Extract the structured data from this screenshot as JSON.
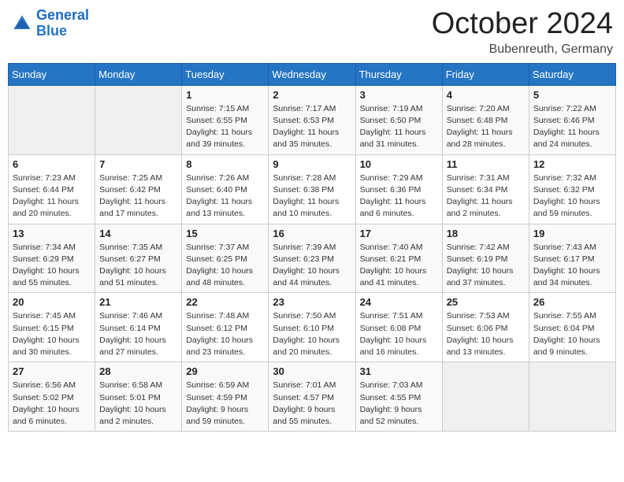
{
  "logo": {
    "text_general": "General",
    "text_blue": "Blue"
  },
  "header": {
    "month": "October 2024",
    "location": "Bubenreuth, Germany"
  },
  "days_of_week": [
    "Sunday",
    "Monday",
    "Tuesday",
    "Wednesday",
    "Thursday",
    "Friday",
    "Saturday"
  ],
  "weeks": [
    [
      {
        "day": null,
        "info": null
      },
      {
        "day": null,
        "info": null
      },
      {
        "day": "1",
        "info": "Sunrise: 7:15 AM\nSunset: 6:55 PM\nDaylight: 11 hours and 39 minutes."
      },
      {
        "day": "2",
        "info": "Sunrise: 7:17 AM\nSunset: 6:53 PM\nDaylight: 11 hours and 35 minutes."
      },
      {
        "day": "3",
        "info": "Sunrise: 7:19 AM\nSunset: 6:50 PM\nDaylight: 11 hours and 31 minutes."
      },
      {
        "day": "4",
        "info": "Sunrise: 7:20 AM\nSunset: 6:48 PM\nDaylight: 11 hours and 28 minutes."
      },
      {
        "day": "5",
        "info": "Sunrise: 7:22 AM\nSunset: 6:46 PM\nDaylight: 11 hours and 24 minutes."
      }
    ],
    [
      {
        "day": "6",
        "info": "Sunrise: 7:23 AM\nSunset: 6:44 PM\nDaylight: 11 hours and 20 minutes."
      },
      {
        "day": "7",
        "info": "Sunrise: 7:25 AM\nSunset: 6:42 PM\nDaylight: 11 hours and 17 minutes."
      },
      {
        "day": "8",
        "info": "Sunrise: 7:26 AM\nSunset: 6:40 PM\nDaylight: 11 hours and 13 minutes."
      },
      {
        "day": "9",
        "info": "Sunrise: 7:28 AM\nSunset: 6:38 PM\nDaylight: 11 hours and 10 minutes."
      },
      {
        "day": "10",
        "info": "Sunrise: 7:29 AM\nSunset: 6:36 PM\nDaylight: 11 hours and 6 minutes."
      },
      {
        "day": "11",
        "info": "Sunrise: 7:31 AM\nSunset: 6:34 PM\nDaylight: 11 hours and 2 minutes."
      },
      {
        "day": "12",
        "info": "Sunrise: 7:32 AM\nSunset: 6:32 PM\nDaylight: 10 hours and 59 minutes."
      }
    ],
    [
      {
        "day": "13",
        "info": "Sunrise: 7:34 AM\nSunset: 6:29 PM\nDaylight: 10 hours and 55 minutes."
      },
      {
        "day": "14",
        "info": "Sunrise: 7:35 AM\nSunset: 6:27 PM\nDaylight: 10 hours and 51 minutes."
      },
      {
        "day": "15",
        "info": "Sunrise: 7:37 AM\nSunset: 6:25 PM\nDaylight: 10 hours and 48 minutes."
      },
      {
        "day": "16",
        "info": "Sunrise: 7:39 AM\nSunset: 6:23 PM\nDaylight: 10 hours and 44 minutes."
      },
      {
        "day": "17",
        "info": "Sunrise: 7:40 AM\nSunset: 6:21 PM\nDaylight: 10 hours and 41 minutes."
      },
      {
        "day": "18",
        "info": "Sunrise: 7:42 AM\nSunset: 6:19 PM\nDaylight: 10 hours and 37 minutes."
      },
      {
        "day": "19",
        "info": "Sunrise: 7:43 AM\nSunset: 6:17 PM\nDaylight: 10 hours and 34 minutes."
      }
    ],
    [
      {
        "day": "20",
        "info": "Sunrise: 7:45 AM\nSunset: 6:15 PM\nDaylight: 10 hours and 30 minutes."
      },
      {
        "day": "21",
        "info": "Sunrise: 7:46 AM\nSunset: 6:14 PM\nDaylight: 10 hours and 27 minutes."
      },
      {
        "day": "22",
        "info": "Sunrise: 7:48 AM\nSunset: 6:12 PM\nDaylight: 10 hours and 23 minutes."
      },
      {
        "day": "23",
        "info": "Sunrise: 7:50 AM\nSunset: 6:10 PM\nDaylight: 10 hours and 20 minutes."
      },
      {
        "day": "24",
        "info": "Sunrise: 7:51 AM\nSunset: 6:08 PM\nDaylight: 10 hours and 16 minutes."
      },
      {
        "day": "25",
        "info": "Sunrise: 7:53 AM\nSunset: 6:06 PM\nDaylight: 10 hours and 13 minutes."
      },
      {
        "day": "26",
        "info": "Sunrise: 7:55 AM\nSunset: 6:04 PM\nDaylight: 10 hours and 9 minutes."
      }
    ],
    [
      {
        "day": "27",
        "info": "Sunrise: 6:56 AM\nSunset: 5:02 PM\nDaylight: 10 hours and 6 minutes."
      },
      {
        "day": "28",
        "info": "Sunrise: 6:58 AM\nSunset: 5:01 PM\nDaylight: 10 hours and 2 minutes."
      },
      {
        "day": "29",
        "info": "Sunrise: 6:59 AM\nSunset: 4:59 PM\nDaylight: 9 hours and 59 minutes."
      },
      {
        "day": "30",
        "info": "Sunrise: 7:01 AM\nSunset: 4:57 PM\nDaylight: 9 hours and 55 minutes."
      },
      {
        "day": "31",
        "info": "Sunrise: 7:03 AM\nSunset: 4:55 PM\nDaylight: 9 hours and 52 minutes."
      },
      {
        "day": null,
        "info": null
      },
      {
        "day": null,
        "info": null
      }
    ]
  ]
}
